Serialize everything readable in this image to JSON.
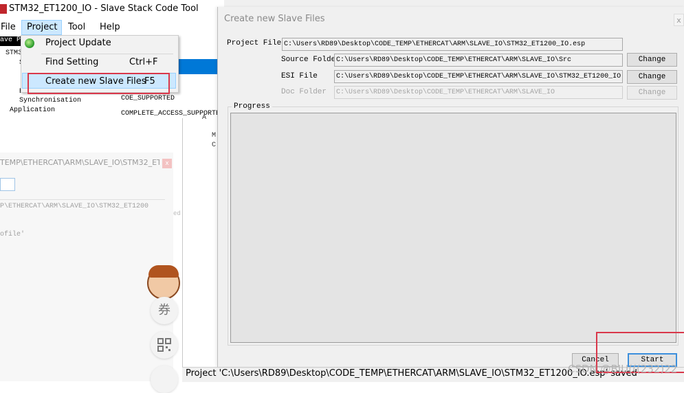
{
  "app": {
    "title": "STM32_ET1200_IO - Slave Stack Code Tool",
    "menu": {
      "file": "File",
      "project": "Project",
      "tool": "Tool",
      "help": "Help"
    },
    "tree": {
      "selected": "ave P",
      "items": [
        "STM3",
        "S",
        "",
        "EtherCAT State Machine",
        "Synchronisation",
        "Application"
      ]
    },
    "right_list": [
      "s",
      "",
      "",
      "COE_SUPPORTED",
      "COMPLETE_ACCESS_SUPPORTED"
    ]
  },
  "dropdown": {
    "items": [
      {
        "label": "Project Update",
        "shortcut": ""
      },
      {
        "label": "Find Setting",
        "shortcut": "Ctrl+F"
      },
      {
        "label": "Create new Slave Files",
        "shortcut": "F5"
      }
    ]
  },
  "bg_dialog": {
    "title": "TEMP\\ETHERCAT\\ARM\\SLAVE_IO\\STM32_ET...",
    "close": "x",
    "path_line": "P\\ETHERCAT\\ARM\\SLAVE_IO\\STM32_ET1200",
    "profile": "ofile'",
    "side_text": "ed"
  },
  "middle_tree": [
    "A",
    "M",
    "C"
  ],
  "dialog": {
    "title": "Create new Slave Files",
    "close": "x",
    "rows": [
      {
        "label": "Project File",
        "value": "C:\\Users\\RD89\\Desktop\\CODE_TEMP\\ETHERCAT\\ARM\\SLAVE_IO\\STM32_ET1200_IO.esp",
        "button": ""
      },
      {
        "label": "Source Folder",
        "value": "C:\\Users\\RD89\\Desktop\\CODE_TEMP\\ETHERCAT\\ARM\\SLAVE_IO\\Src",
        "button": "Change"
      },
      {
        "label": "ESI File",
        "value": "C:\\Users\\RD89\\Desktop\\CODE_TEMP\\ETHERCAT\\ARM\\SLAVE_IO\\STM32_ET1200_IO",
        "button": "Change"
      },
      {
        "label": "Doc Folder",
        "value": "C:\\Users\\RD89\\Desktop\\CODE_TEMP\\ETHERCAT\\ARM\\SLAVE_IO",
        "button": "Change"
      }
    ],
    "progress_label": "Progress",
    "cancel": "Cancel",
    "start": "Start"
  },
  "statusbar": {
    "text": "Project 'C:\\Users\\RD89\\Desktop\\CODE_TEMP\\ETHERCAT\\ARM\\SLAVE_IO\\STM32_ET1200_IO.esp' saved"
  },
  "watermark": "CSDN @BIU(((232)22",
  "side_widgets": {
    "coupon": "券"
  },
  "colors": {
    "highlight": "#cce8ff",
    "selection": "#0078d7",
    "annotation_red": "#d9374a"
  }
}
